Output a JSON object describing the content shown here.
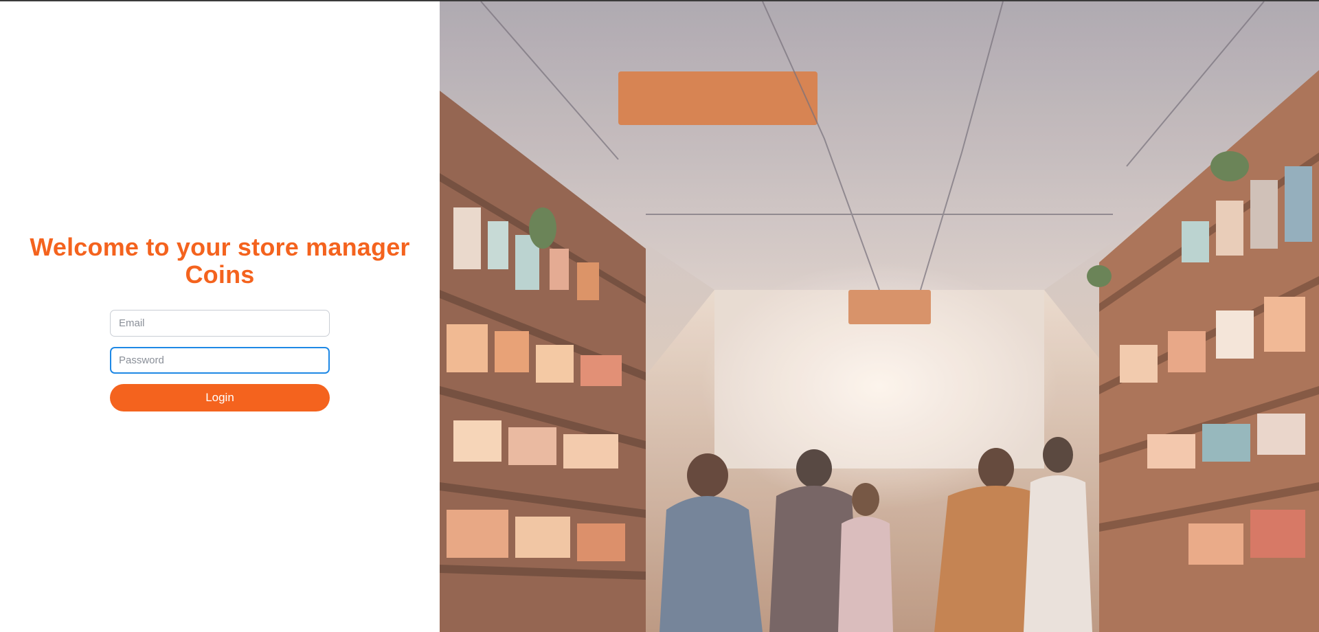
{
  "welcome": {
    "title_line1": "Welcome to your store manager",
    "title_line2": "Coins"
  },
  "login_form": {
    "email_placeholder": "Email",
    "password_placeholder": "Password",
    "login_label": "Login"
  },
  "hero_image": {
    "subject": "store-interior-illustration"
  },
  "colors": {
    "accent": "#f4631e",
    "focus_ring": "#1e88e5",
    "background": "#ffffff"
  }
}
